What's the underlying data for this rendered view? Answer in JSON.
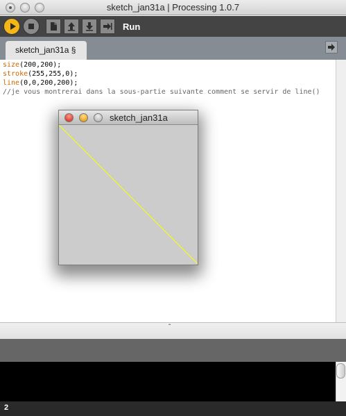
{
  "window": {
    "title": "sketch_jan31a | Processing 1.0.7"
  },
  "toolbar": {
    "run_label": "Run",
    "icons": [
      "run-icon",
      "stop-icon",
      "new-icon",
      "open-icon",
      "save-icon",
      "export-icon"
    ],
    "run_color": "#f6b716"
  },
  "tabs": [
    {
      "label": "sketch_jan31a §"
    }
  ],
  "editor": {
    "lines": [
      {
        "fn": "size",
        "args": "(200,200);"
      },
      {
        "fn": "stroke",
        "args": "(255,255,0);"
      },
      {
        "fn": "line",
        "args": "(0,0,200,200);"
      },
      {
        "comment": "//je vous montrerai dans la sous-partie suivante comment se servir de line()"
      }
    ]
  },
  "sketch_window": {
    "title": "sketch_jan31a",
    "background_color": "#cccccc",
    "line_color": "#ffff00"
  },
  "status": {
    "line_number": "2"
  }
}
